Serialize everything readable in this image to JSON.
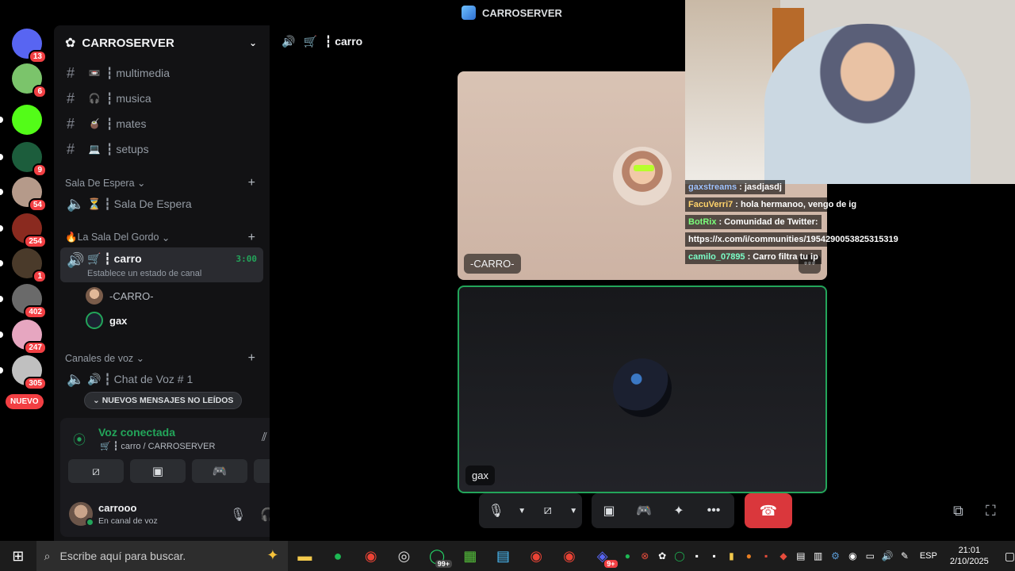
{
  "window": {
    "title": "CARROSERVER"
  },
  "rail": {
    "servers": [
      {
        "name": "discord-home",
        "badge": "13",
        "color": "#5865f2"
      },
      {
        "name": "server-avatar-1",
        "badge": "6",
        "color": "#7bc46b"
      },
      {
        "name": "kick",
        "badge": "",
        "color": "#53fc18"
      },
      {
        "name": "server-green",
        "badge": "9",
        "color": "#1c5d3c"
      },
      {
        "name": "server-4",
        "badge": "54",
        "color": "#b59a8a"
      },
      {
        "name": "server-5",
        "badge": "254",
        "color": "#8a2a1f"
      },
      {
        "name": "server-6",
        "badge": "1",
        "color": "#4a3a2a"
      },
      {
        "name": "server-7",
        "badge": "402",
        "color": "#6a6a6a"
      },
      {
        "name": "server-8",
        "badge": "247",
        "color": "#e6a6c0"
      },
      {
        "name": "server-9",
        "badge": "305",
        "color": "#c0c0c0"
      }
    ],
    "nuevo": "NUEVO"
  },
  "sidebar": {
    "server_name": "CARROSERVER",
    "text_channels": [
      {
        "emoji": "📼",
        "name": "┇ multimedia"
      },
      {
        "emoji": "🎧",
        "name": "┇ musica"
      },
      {
        "emoji": "🧉",
        "name": "┇ mates"
      },
      {
        "emoji": "💻",
        "name": "┇ setups"
      }
    ],
    "cat_espera": "Sala De Espera",
    "espera_channel": "⏳ ┇ Sala De Espera",
    "cat_gordo": "🔥La Sala Del Gordo",
    "active_channel": "🛒 ┇ carro",
    "active_timer": "3:00",
    "active_status": "Establece un estado de canal",
    "voice_users": [
      "-CARRO-",
      "gax"
    ],
    "cat_voz": "Canales de voz",
    "voz_channel": "🔊 ┇ Chat de Voz # 1",
    "unread": "NUEVOS MENSAJES NO LEÍDOS"
  },
  "voicepanel": {
    "title": "Voz conectada",
    "subtitle": "🛒 ┇ carro / CARROSERVER",
    "username": "carrooo",
    "user_status": "En canal de voz"
  },
  "main": {
    "channel_title": "┇ carro",
    "tile1_name": "-CARRO-",
    "tile2_name": "gax"
  },
  "chat": [
    {
      "user": "gaxstreams",
      "color": "#9ec3ff",
      "text": ": jasdjasdj"
    },
    {
      "user": "FacuVerri7",
      "color": "#ffd36b",
      "text": ": hola hermanoo, vengo de ig"
    },
    {
      "user": "BotRix",
      "color": "#7bff7b",
      "text": ": Comunidad de Twitter:"
    },
    {
      "user": "",
      "color": "#ffffff",
      "text": "https://x.com/i/communities/1954290053825315319"
    },
    {
      "user": "camilo_07895",
      "color": "#7bffc8",
      "text": ": Carro filtra tu ip"
    }
  ],
  "taskbar": {
    "search_placeholder": "Escribe aquí para buscar.",
    "whatsapp_badge": "99+",
    "discord_badge": "9+",
    "lang": "ESP",
    "time": "21:01",
    "date": "2/10/2025"
  }
}
